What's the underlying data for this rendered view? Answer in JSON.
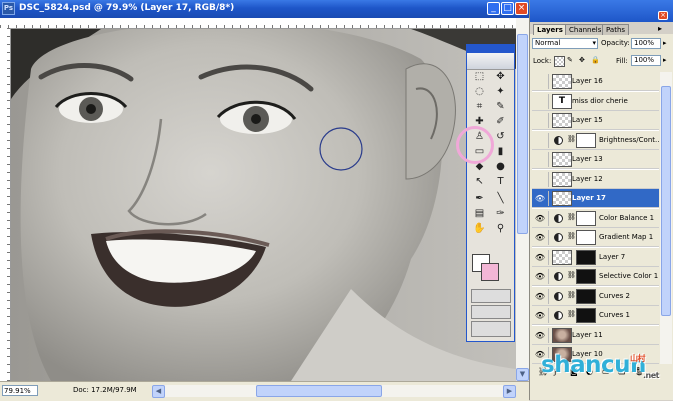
{
  "window": {
    "title": "DSC_5824.psd @ 79.9% (Layer 17, RGB/8*)",
    "app_icon": "Ps",
    "controls": {
      "minimize": "_",
      "maximize": "□",
      "close": "×"
    }
  },
  "status": {
    "zoom": "79.91%",
    "doc": "Doc: 17.2M/97.9M"
  },
  "layers_panel": {
    "tabs": [
      "Layers",
      "Channels",
      "Paths"
    ],
    "active_tab": "Layers",
    "blend_mode": "Normal",
    "opacity_label": "Opacity:",
    "opacity_value": "100%",
    "lock_label": "Lock:",
    "fill_label": "Fill:",
    "fill_value": "100%",
    "layers": [
      {
        "name": "Layer 16",
        "kind": "pixel",
        "visible": false,
        "selected": false
      },
      {
        "name": "miss dior cherie",
        "kind": "text",
        "visible": false,
        "selected": false
      },
      {
        "name": "Layer 15",
        "kind": "pixel",
        "visible": false,
        "selected": false
      },
      {
        "name": "Brightness/Cont...",
        "kind": "adjustment",
        "visible": false,
        "selected": false
      },
      {
        "name": "Layer 13",
        "kind": "pixel",
        "visible": false,
        "selected": false
      },
      {
        "name": "Layer 12",
        "kind": "pixel",
        "visible": false,
        "selected": false
      },
      {
        "name": "Layer 17",
        "kind": "pixel",
        "visible": true,
        "selected": true
      },
      {
        "name": "Color Balance 1",
        "kind": "adjustment",
        "visible": true,
        "selected": false
      },
      {
        "name": "Gradient Map 1",
        "kind": "adjustment",
        "visible": true,
        "selected": false
      },
      {
        "name": "Layer 7",
        "kind": "pixel",
        "visible": true,
        "selected": false
      },
      {
        "name": "Selective Color 1",
        "kind": "adjustment",
        "visible": true,
        "selected": false
      },
      {
        "name": "Curves 2",
        "kind": "adjustment",
        "visible": true,
        "selected": false
      },
      {
        "name": "Curves 1",
        "kind": "adjustment",
        "visible": true,
        "selected": false
      },
      {
        "name": "Layer 11",
        "kind": "image",
        "visible": true,
        "selected": false
      },
      {
        "name": "Layer 10",
        "kind": "image",
        "visible": true,
        "selected": false
      }
    ]
  },
  "tools": [
    {
      "icon": "marquee-icon",
      "glyph": "⬚"
    },
    {
      "icon": "move-icon",
      "glyph": "✥"
    },
    {
      "icon": "lasso-icon",
      "glyph": "◌"
    },
    {
      "icon": "magic-wand-icon",
      "glyph": "✦"
    },
    {
      "icon": "crop-icon",
      "glyph": "⌗"
    },
    {
      "icon": "slice-icon",
      "glyph": "✎"
    },
    {
      "icon": "healing-brush-icon",
      "glyph": "✚"
    },
    {
      "icon": "brush-icon",
      "glyph": "✐"
    },
    {
      "icon": "clone-stamp-icon",
      "glyph": "♙"
    },
    {
      "icon": "history-brush-icon",
      "glyph": "↺"
    },
    {
      "icon": "eraser-icon",
      "glyph": "▭"
    },
    {
      "icon": "gradient-icon",
      "glyph": "▮"
    },
    {
      "icon": "blur-icon",
      "glyph": "◆"
    },
    {
      "icon": "dodge-icon",
      "glyph": "●"
    },
    {
      "icon": "path-select-icon",
      "glyph": "↖"
    },
    {
      "icon": "type-icon",
      "glyph": "T"
    },
    {
      "icon": "pen-icon",
      "glyph": "✒"
    },
    {
      "icon": "line-icon",
      "glyph": "╲"
    },
    {
      "icon": "notes-icon",
      "glyph": "▤"
    },
    {
      "icon": "eyedropper-icon",
      "glyph": "✑"
    },
    {
      "icon": "hand-icon",
      "glyph": "✋"
    },
    {
      "icon": "zoom-icon",
      "glyph": "⚲"
    }
  ],
  "watermark": {
    "text": "shancun",
    "small": "山村",
    "net": ".net"
  },
  "colors": {
    "title_blue": "#1e56c8",
    "selected_layer": "#3169c6",
    "highlight_pink": "#f0a8d8",
    "bg_swatch": "#f3b6d6",
    "brush_circle": "#2a3c8c"
  }
}
